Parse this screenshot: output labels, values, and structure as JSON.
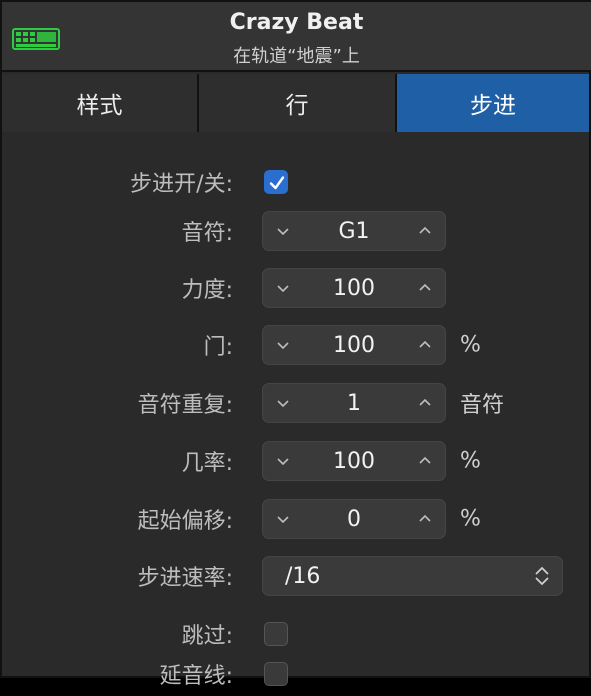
{
  "header": {
    "title": "Crazy Beat",
    "subtitle": "在轨道“地震”上",
    "icon": "step-sequencer-icon",
    "icon_color": "#2ecc40"
  },
  "tabs": [
    {
      "label": "样式",
      "active": false
    },
    {
      "label": "行",
      "active": false
    },
    {
      "label": "步进",
      "active": true
    }
  ],
  "rows": {
    "step_on_off": {
      "label": "步进开/关:",
      "checked": true
    },
    "note": {
      "label": "音符:",
      "value": "G1"
    },
    "velocity": {
      "label": "力度:",
      "value": "100"
    },
    "gate": {
      "label": "门:",
      "value": "100",
      "unit": "%"
    },
    "note_repeat": {
      "label": "音符重复:",
      "value": "1",
      "unit": "音符"
    },
    "probability": {
      "label": "几率:",
      "value": "100",
      "unit": "%"
    },
    "start_offset": {
      "label": "起始偏移:",
      "value": "0",
      "unit": "%"
    },
    "step_rate": {
      "label": "步进速率:",
      "value": "/16"
    },
    "skip": {
      "label": "跳过:",
      "checked": false
    },
    "tie": {
      "label": "延音线:",
      "checked": false
    }
  },
  "colors": {
    "accent": "#1f5fa6",
    "checkbox_checked": "#2a6fcf",
    "panel_bg": "#2a2a2a"
  }
}
